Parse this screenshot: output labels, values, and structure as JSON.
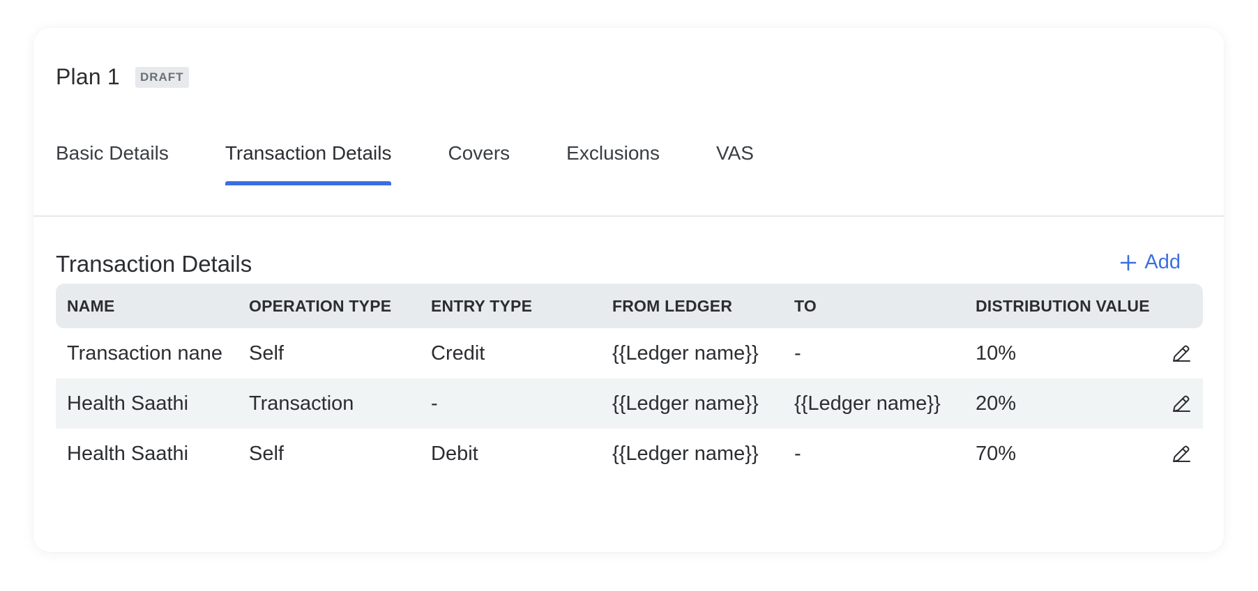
{
  "plan": {
    "title": "Plan 1",
    "status_badge": "DRAFT"
  },
  "tabs": [
    {
      "label": "Basic Details",
      "active": false
    },
    {
      "label": "Transaction Details",
      "active": true
    },
    {
      "label": "Covers",
      "active": false
    },
    {
      "label": "Exclusions",
      "active": false
    },
    {
      "label": "VAS",
      "active": false
    }
  ],
  "section": {
    "title": "Transaction Details",
    "add_label": "Add",
    "add_icon": "plus-icon"
  },
  "table": {
    "columns": [
      "NAME",
      "OPERATION TYPE",
      "ENTRY TYPE",
      "FROM LEDGER",
      "TO",
      "DISTRIBUTION VALUE"
    ],
    "rows": [
      {
        "name": "Transaction nane",
        "operation_type": "Self",
        "entry_type": "Credit",
        "from_ledger": "{{Ledger name}}",
        "to": "-",
        "distribution_value": "10%"
      },
      {
        "name": "Health Saathi",
        "operation_type": "Transaction",
        "entry_type": "-",
        "from_ledger": "{{Ledger name}}",
        "to": "{{Ledger name}}",
        "distribution_value": "20%"
      },
      {
        "name": "Health Saathi",
        "operation_type": "Self",
        "entry_type": "Debit",
        "from_ledger": "{{Ledger name}}",
        "to": "-",
        "distribution_value": "70%"
      }
    ],
    "row_action_icon": "pencil-edit-icon"
  },
  "colors": {
    "accent": "#3b6fe0",
    "header_bg": "#e8ebee",
    "alt_row_bg": "#f1f4f5",
    "badge_bg": "#e7e9ec"
  }
}
